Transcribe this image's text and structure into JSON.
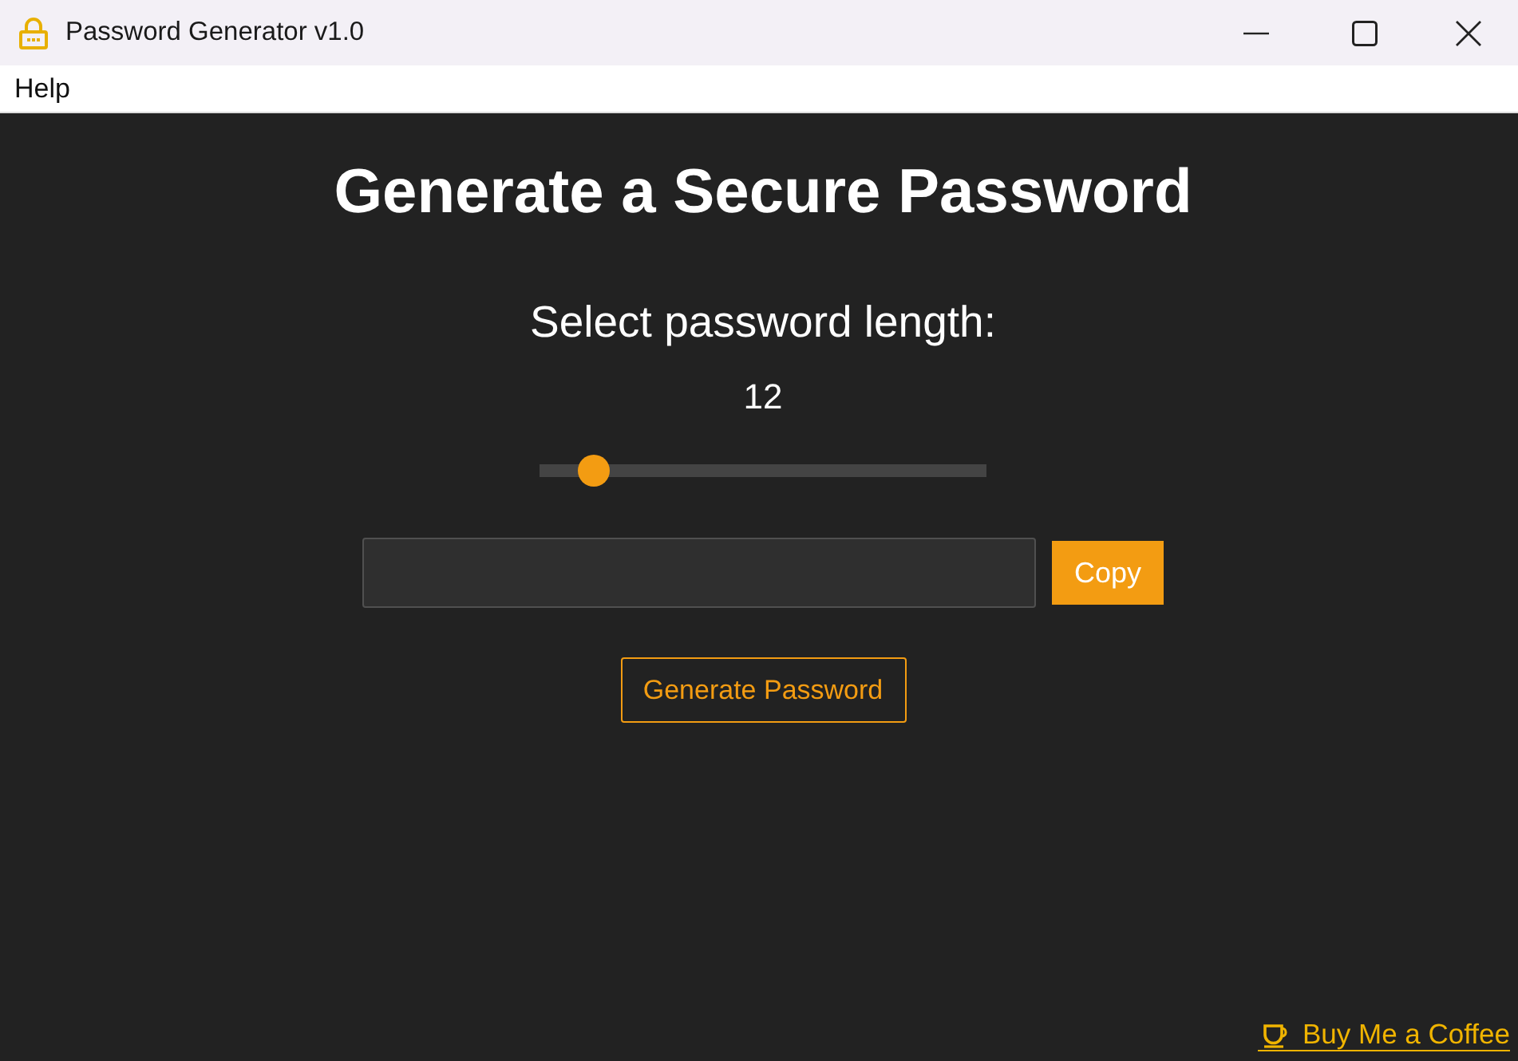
{
  "window": {
    "title": "Password Generator v1.0"
  },
  "menu": [
    {
      "label": "Help"
    }
  ],
  "heading": "Generate a Secure Password",
  "length": {
    "label": "Select password length:",
    "value": "12",
    "level": 0.12
  },
  "copy_button": "Copy",
  "generate_button": "Generate Password",
  "footer_link": "Buy Me a Coffee"
}
